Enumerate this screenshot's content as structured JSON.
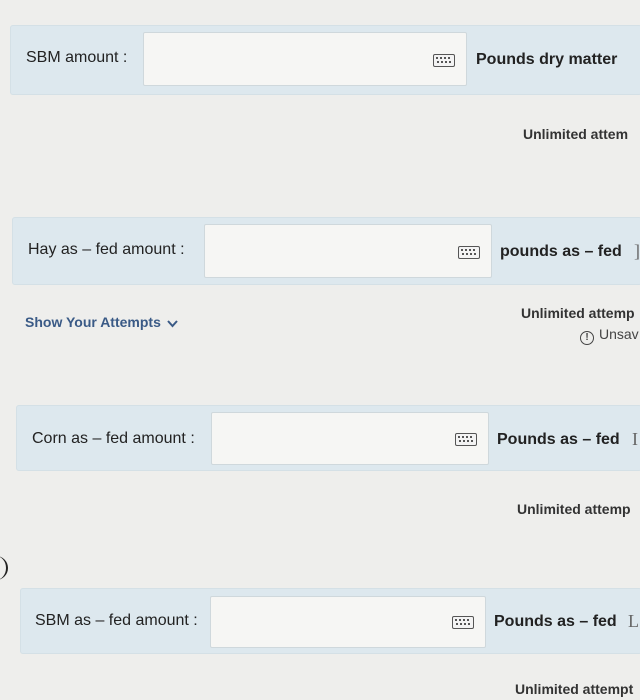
{
  "rows": [
    {
      "label": "SBM amount :",
      "unit": "Pounds dry matter",
      "edge": ""
    },
    {
      "label": "Hay as – fed amount :",
      "unit": "pounds as – fed",
      "edge": "]"
    },
    {
      "label": "Corn as – fed amount :",
      "unit": "Pounds as – fed",
      "edge": "I"
    },
    {
      "label": "SBM as – fed amount :",
      "unit": "Pounds as – fed",
      "edge": "L"
    }
  ],
  "attempts_text": [
    "Unlimited attem",
    "Unlimited attemp",
    "Unlimited attemp",
    "Unlimited attempt"
  ],
  "show_attempts_label": "Show Your Attempts",
  "unsaved_text": "Unsav",
  "icons": {
    "keyboard": "keyboard-icon",
    "chevron": "chevron-down-icon",
    "warning": "warning-icon"
  },
  "colors": {
    "row_bg": "#dde8ee",
    "link": "#3a5a86"
  }
}
